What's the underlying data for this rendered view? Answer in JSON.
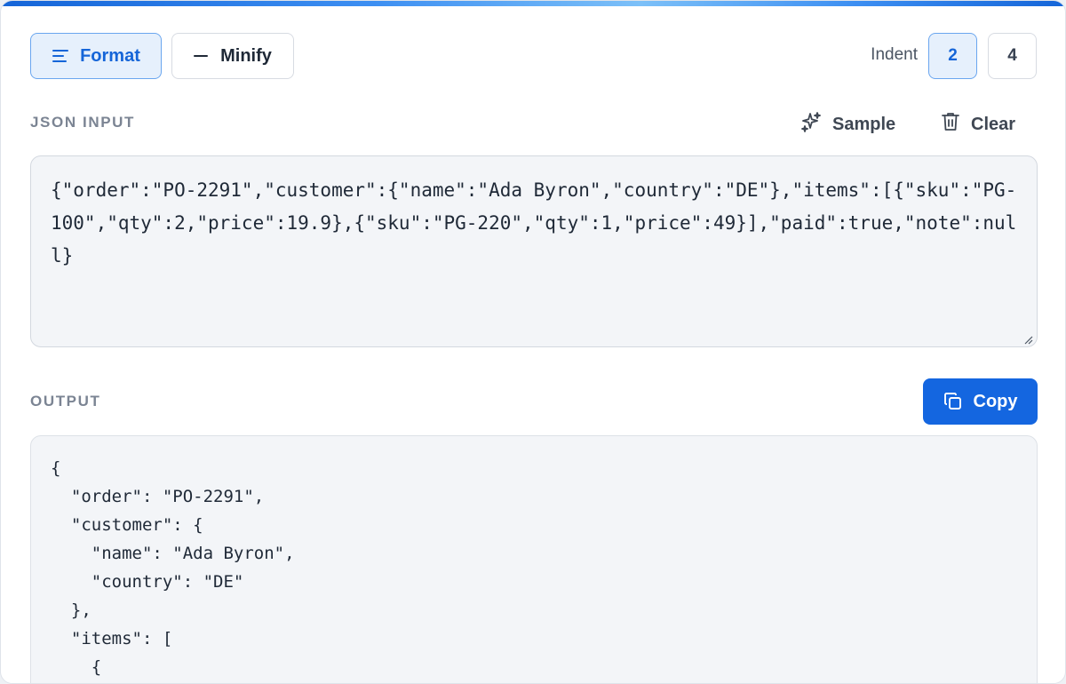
{
  "toolbar": {
    "format_label": "Format",
    "minify_label": "Minify",
    "indent_label": "Indent",
    "indent_options": [
      "2",
      "4"
    ],
    "indent_selected": "2"
  },
  "input_section": {
    "label": "JSON INPUT",
    "sample_label": "Sample",
    "clear_label": "Clear",
    "value": "{\"order\":\"PO-2291\",\"customer\":{\"name\":\"Ada Byron\",\"country\":\"DE\"},\"items\":[{\"sku\":\"PG-100\",\"qty\":2,\"price\":19.9},{\"sku\":\"PG-220\",\"qty\":1,\"price\":49}],\"paid\":true,\"note\":null}"
  },
  "output_section": {
    "label": "OUTPUT",
    "copy_label": "Copy",
    "text": "{\n  \"order\": \"PO-2291\",\n  \"customer\": {\n    \"name\": \"Ada Byron\",\n    \"country\": \"DE\"\n  },\n  \"items\": [\n    {"
  },
  "icons": {
    "format": "align-left-icon",
    "minify": "minus-icon",
    "sample": "sparkles-icon",
    "clear": "trash-icon",
    "copy": "copy-icon"
  },
  "colors": {
    "accent": "#1466e0",
    "accent_light": "#e6f0fc",
    "panel_bg": "#f3f5f8",
    "label_gray": "#7b8493"
  }
}
